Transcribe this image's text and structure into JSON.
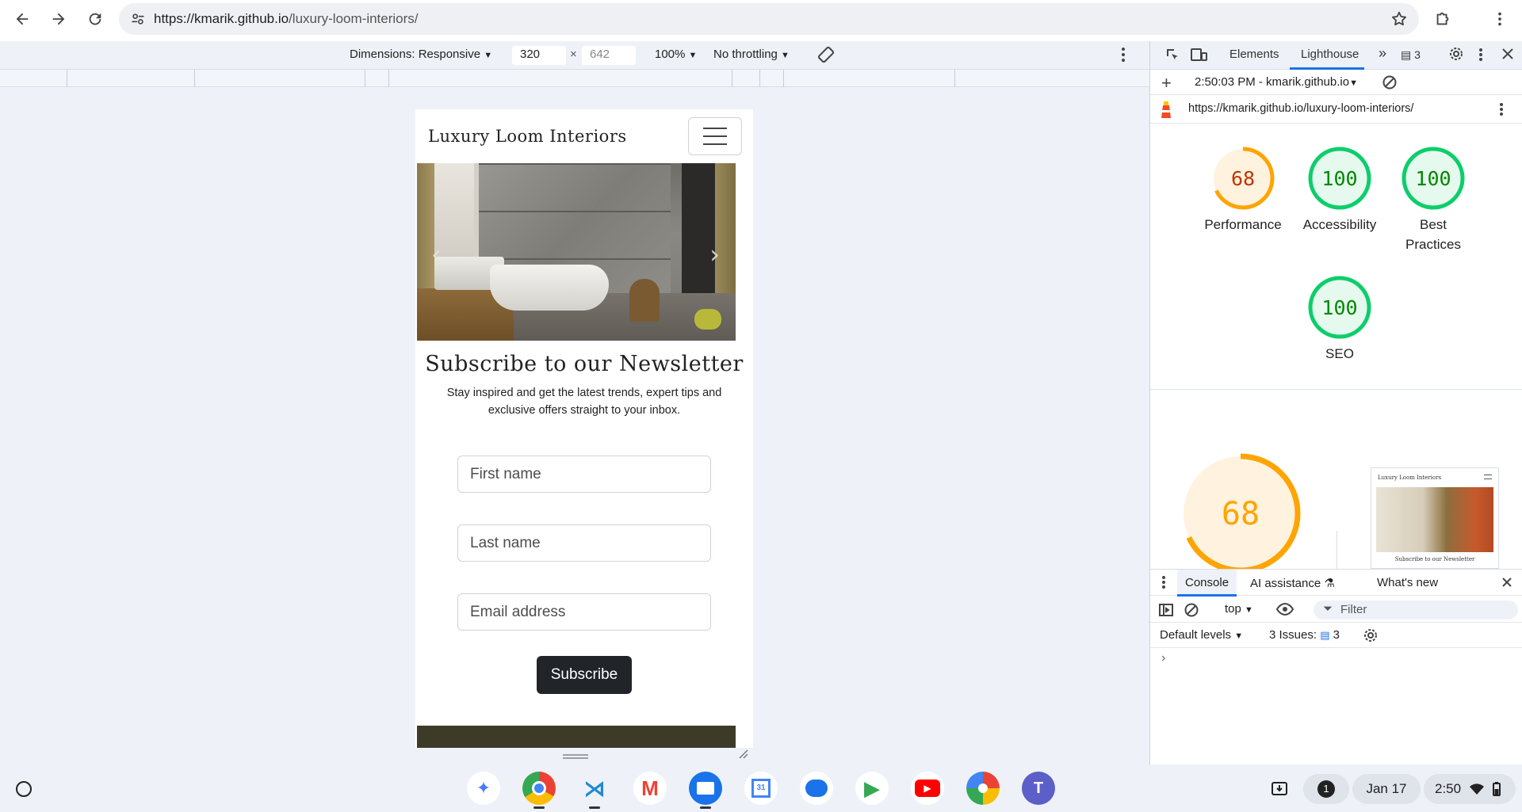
{
  "browser": {
    "url_host": "https://kmarik.github.io",
    "url_path": "/luxury-loom-interiors/"
  },
  "device_toolbar": {
    "dimensions_label": "Dimensions: Responsive",
    "width": "320",
    "times": "×",
    "height": "642",
    "zoom": "100%",
    "throttling": "No throttling"
  },
  "site": {
    "logo": "Luxury Loom Interiors",
    "carousel_prev": "‹",
    "carousel_next": "›",
    "newsletter_title": "Subscribe to our Newsletter",
    "newsletter_text": "Stay inspired and get the latest trends, expert tips and exclusive offers straight to your inbox.",
    "first_name_placeholder": "First name",
    "last_name_placeholder": "Last name",
    "email_placeholder": "Email address",
    "subscribe_label": "Subscribe"
  },
  "devtools": {
    "tabs": [
      "Elements",
      "Lighthouse"
    ],
    "issues_count": "3",
    "report_time": "2:50:03 PM - kmarik.github.io",
    "report_url": "https://kmarik.github.io/luxury-loom-interiors/",
    "scores": [
      {
        "label": "Performance",
        "value": 68,
        "color": "#ffa400",
        "text_color": "#c33300",
        "fill": "#fff3e0"
      },
      {
        "label": "Accessibility",
        "value": 100,
        "color": "#0cce6b",
        "text_color": "#008800",
        "fill": "#e6f9ee"
      },
      {
        "label": "Best Practices",
        "value": 100,
        "color": "#0cce6b",
        "text_color": "#008800",
        "fill": "#e6f9ee"
      },
      {
        "label": "SEO",
        "value": 100,
        "color": "#0cce6b",
        "text_color": "#008800",
        "fill": "#e6f9ee"
      }
    ],
    "big_score": 68,
    "thumb_logo": "Luxury Loom Interiors",
    "thumb_caption": "Subscribe to our Newsletter",
    "drawer_tabs": [
      "Console",
      "AI assistance",
      "What's new"
    ],
    "context": "top",
    "filter_placeholder": "Filter",
    "default_levels": "Default levels",
    "issues_label": "3 Issues:",
    "issues_badge": "3",
    "prompt": "›"
  },
  "shelf": {
    "notification_count": "1",
    "date": "Jan 17",
    "time": "2:50"
  },
  "colors": {
    "accent": "#1a73e8",
    "perf_orange": "#ffa400",
    "pass_green": "#0cce6b"
  }
}
